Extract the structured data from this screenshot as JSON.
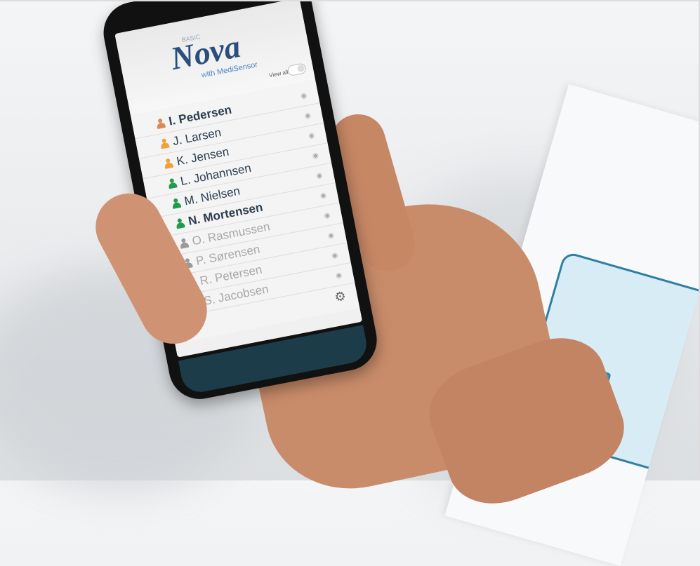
{
  "app": {
    "logo": "Nova",
    "logo_prefix": "BASIC",
    "logo_tag": "with MediSensor",
    "view_all_label": "View all"
  },
  "patients": [
    {
      "name": "I. Pedersen",
      "status": "alert",
      "bold": true
    },
    {
      "name": "J. Larsen",
      "status": "warning",
      "bold": false
    },
    {
      "name": "K. Jensen",
      "status": "warning",
      "bold": false
    },
    {
      "name": "L. Johannsen",
      "status": "ok",
      "bold": false
    },
    {
      "name": "M. Nielsen",
      "status": "ok",
      "bold": false
    },
    {
      "name": "N. Mortensen",
      "status": "ok",
      "bold": true
    },
    {
      "name": "O. Rasmussen",
      "status": "inactive",
      "bold": false
    },
    {
      "name": "P. Sørensen",
      "status": "inactive",
      "bold": false
    },
    {
      "name": "R. Petersen",
      "status": "inactive",
      "bold": false
    },
    {
      "name": "S. Jacobsen",
      "status": "inactive",
      "bold": false
    }
  ],
  "colors": {
    "alert": "#d98a55",
    "warning": "#f0a13a",
    "ok": "#1f9d4c",
    "inactive": "#9a9a9a",
    "logo": "#2b4f7c",
    "accent": "#4a86c6"
  },
  "icons": {
    "person": "person-icon",
    "eye": "eye-icon",
    "settings": "gear-icon"
  }
}
